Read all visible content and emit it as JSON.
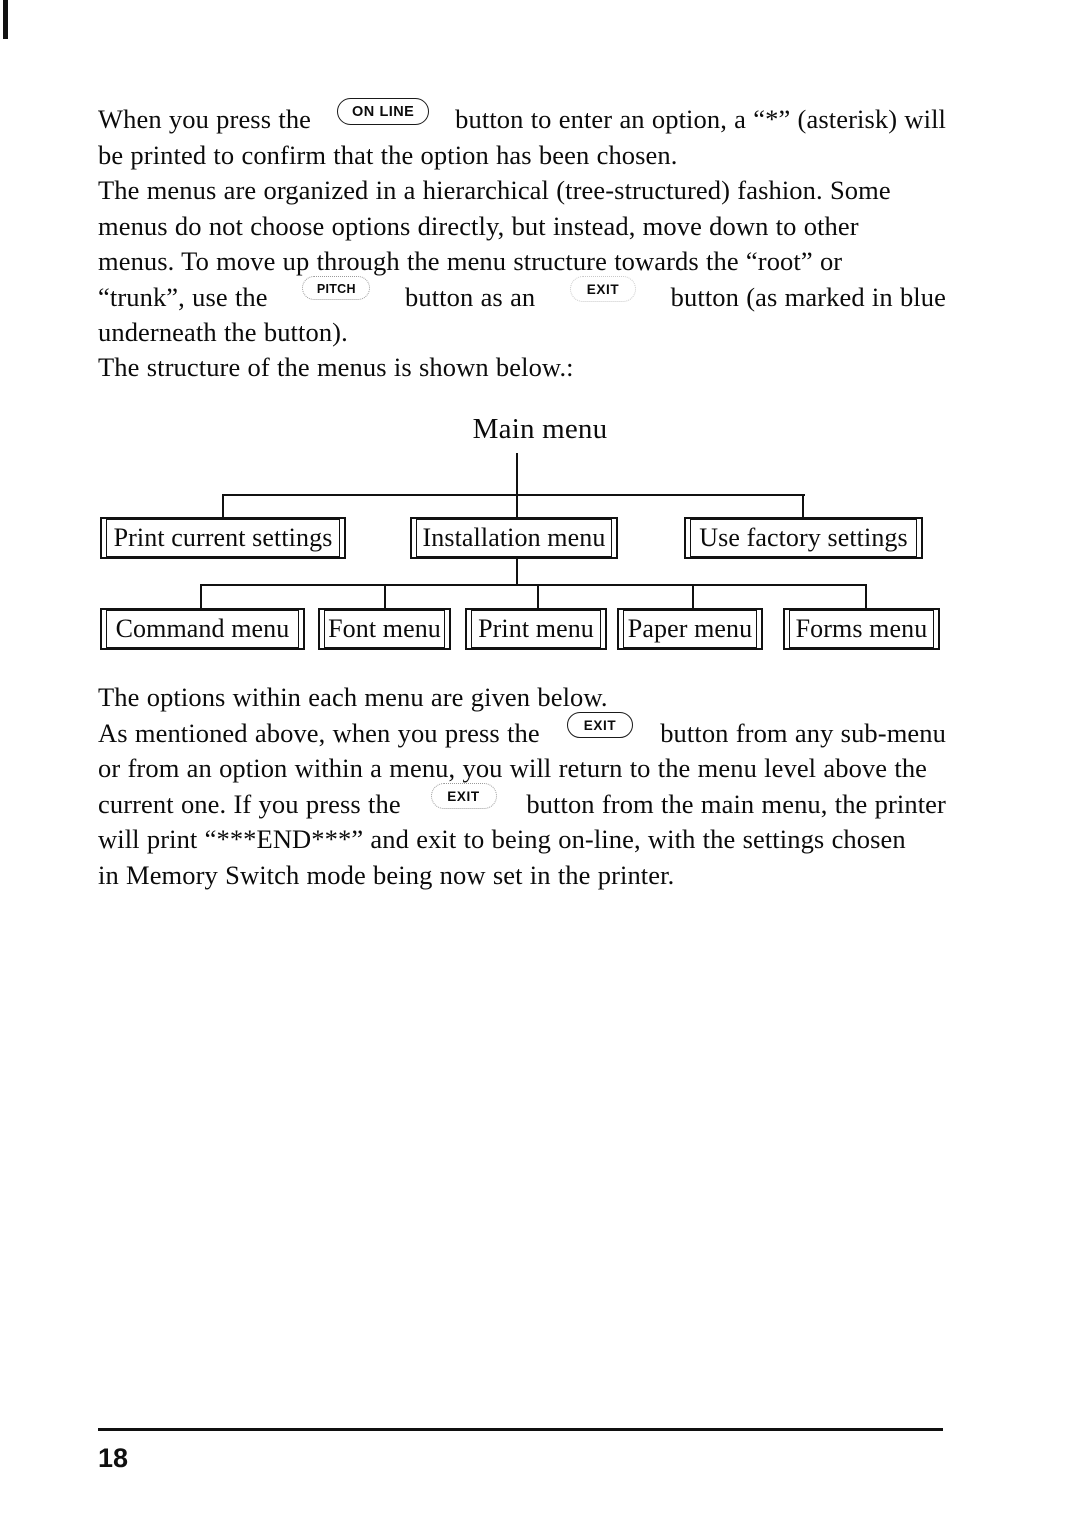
{
  "page": {
    "number": "18",
    "keys": {
      "on_line": "ON LINE",
      "pitch": "PITCH",
      "exit": "EXIT"
    }
  },
  "paragraphs": {
    "p1": {
      "line1_a": "When you press the",
      "line1_b": "button to enter an option, a “*” (asterisk) will",
      "line2": "be printed to confirm that the option has been chosen."
    },
    "p2": {
      "line1": "The menus are organized in a hierarchical (tree-structured) fashion. Some",
      "line2": "menus do not choose options directly, but instead, move down to other",
      "line3": "menus. To move up through the menu structure towards the “root” or",
      "line4_a": "“trunk”, use the",
      "line4_b": "button as an",
      "line4_c": "button (as marked in blue",
      "line5": "underneath the button)."
    },
    "p3": {
      "line1": "The structure of the menus is shown below.:"
    },
    "p4": {
      "line1": "The options within each menu are given below.",
      "line2_a": "As mentioned above, when you press the",
      "line2_b": "button from any sub-menu",
      "line3": "or from an option within a menu, you will return to the menu level above the",
      "line4_a": "current one. If you press the",
      "line4_b": "button from the main menu, the printer",
      "line5": "will print “***END***” and exit to being on-line, with the settings chosen",
      "line6": "in Memory Switch mode being now set in the printer."
    }
  },
  "diagram": {
    "title": "Main menu",
    "level1": [
      {
        "label": "Print current settings"
      },
      {
        "label": "Installation menu"
      },
      {
        "label": "Use factory settings"
      }
    ],
    "level2": [
      {
        "label": "Command menu"
      },
      {
        "label": "Font menu"
      },
      {
        "label": "Print menu"
      },
      {
        "label": "Paper menu"
      },
      {
        "label": "Forms menu"
      }
    ]
  }
}
